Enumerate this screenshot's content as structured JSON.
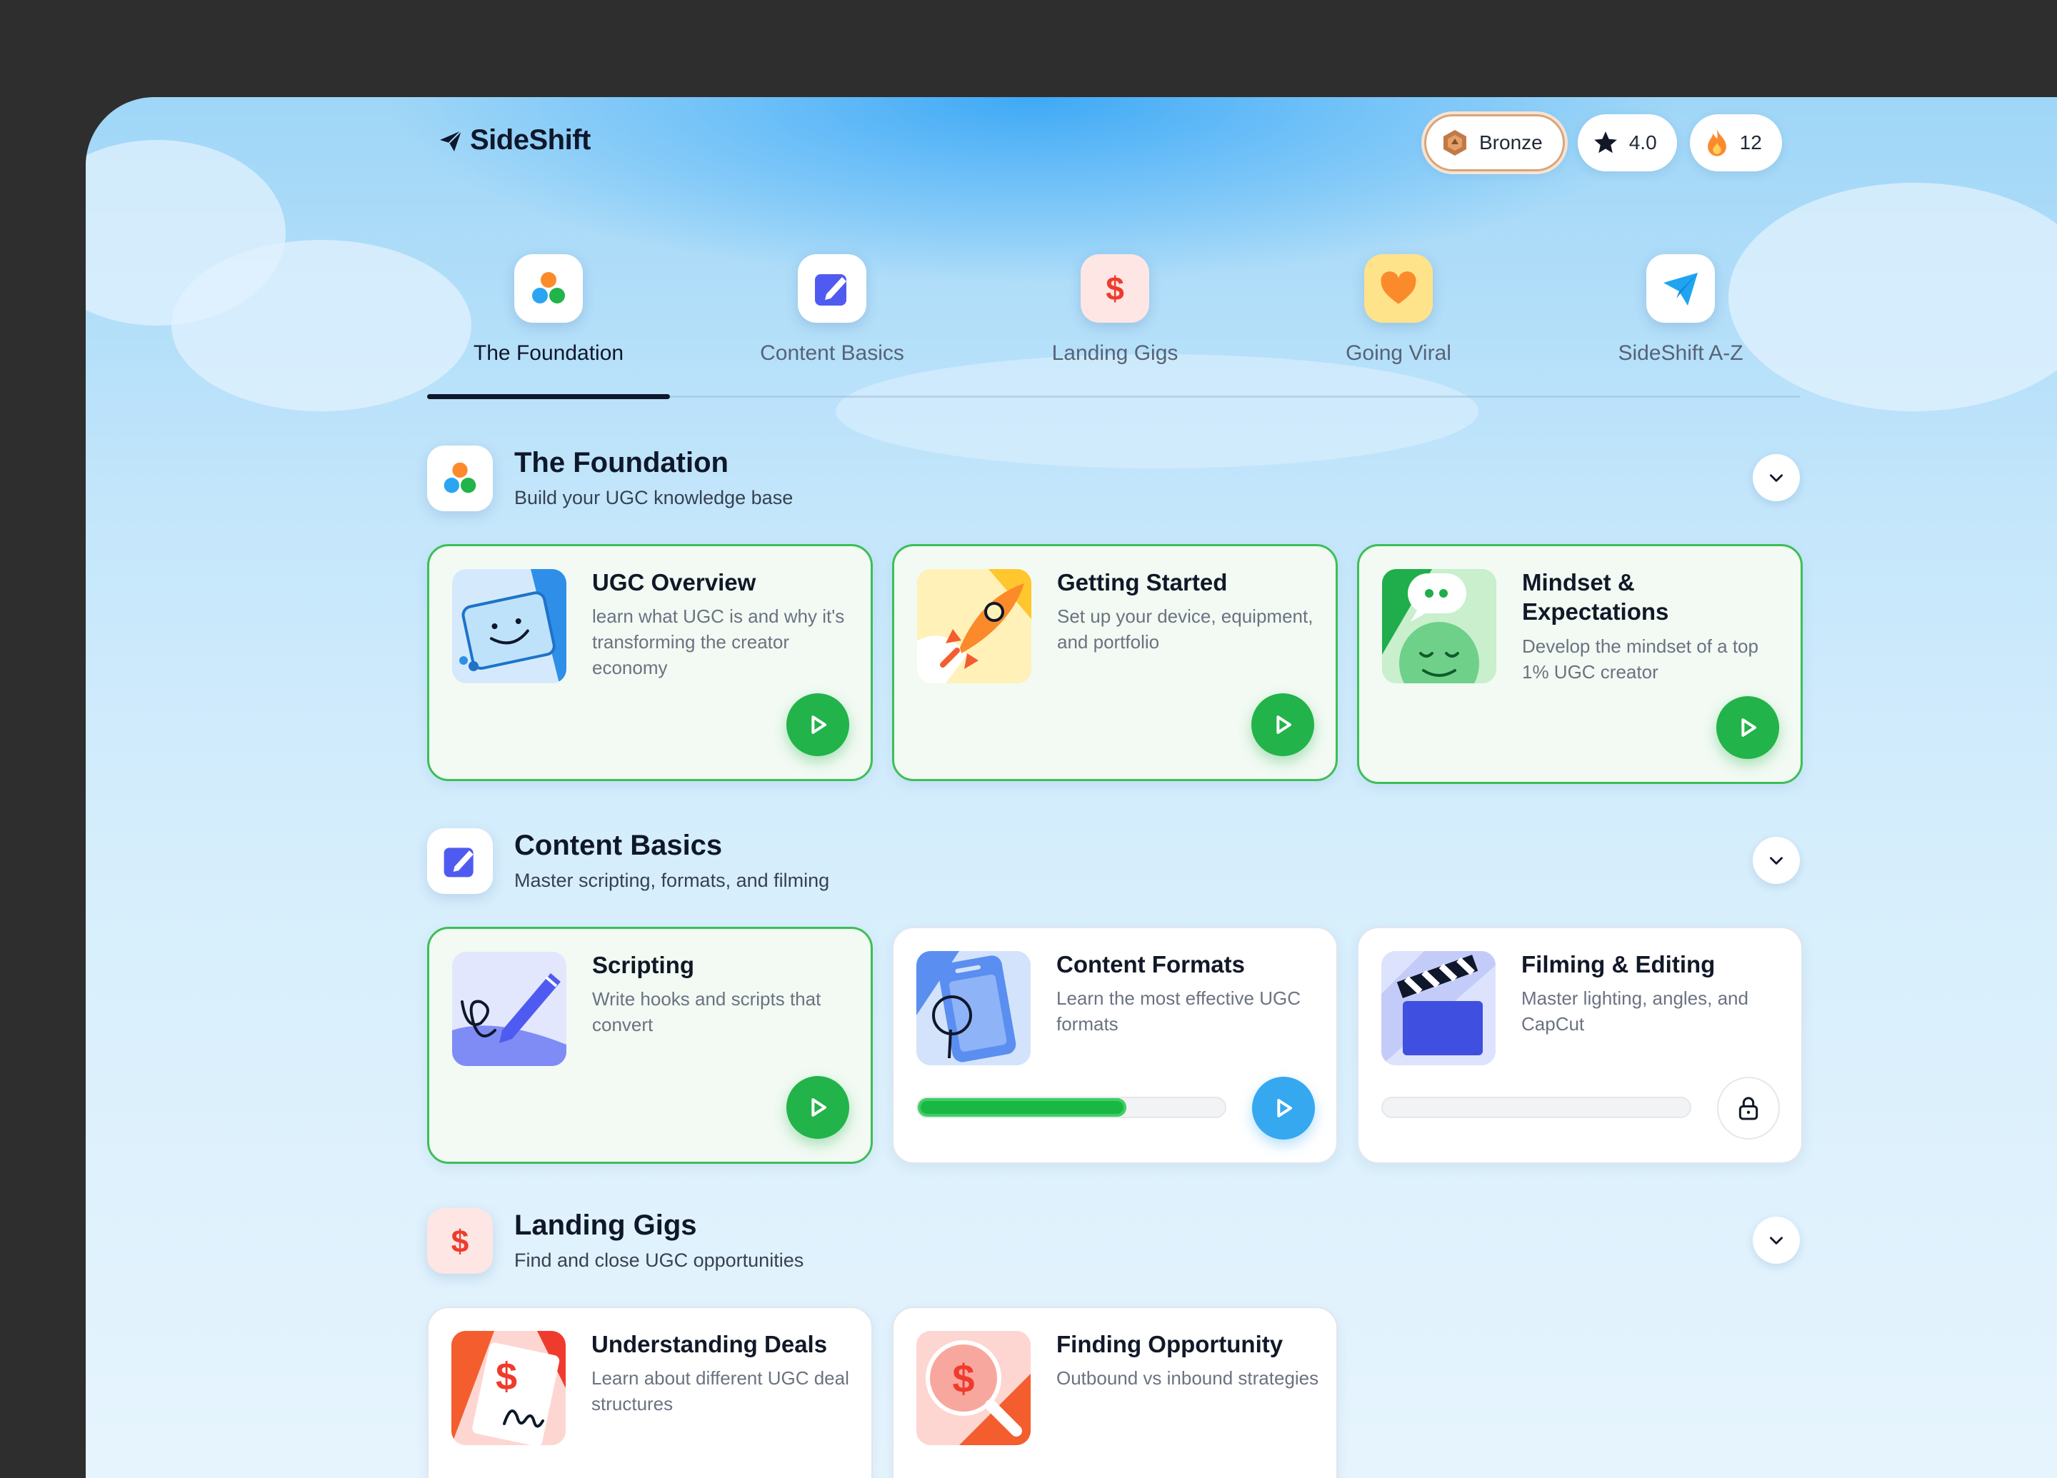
{
  "brand": {
    "name": "SideShift"
  },
  "status": {
    "tier": "Bronze",
    "rating": "4.0",
    "streak": "12"
  },
  "tabs": [
    {
      "label": "The Foundation",
      "icon": "dots-icon"
    },
    {
      "label": "Content Basics",
      "icon": "edit-icon"
    },
    {
      "label": "Landing Gigs",
      "icon": "dollar-icon"
    },
    {
      "label": "Going Viral",
      "icon": "heart-icon"
    },
    {
      "label": "SideShift A-Z",
      "icon": "paper-plane-icon"
    }
  ],
  "active_tab": "The Foundation",
  "sections": [
    {
      "title": "The Foundation",
      "subtitle": "Build your UGC knowledge base",
      "cards": [
        {
          "title": "UGC Overview",
          "desc": "learn what UGC is and why it's transforming the creator economy",
          "state": "completed"
        },
        {
          "title": "Getting Started",
          "desc": "Set up your device, equipment, and portfolio",
          "state": "completed"
        },
        {
          "title": "Mindset & Expectations",
          "desc": "Develop the mindset of a top 1% UGC creator",
          "state": "completed"
        }
      ]
    },
    {
      "title": "Content Basics",
      "subtitle": "Master scripting, formats, and filming",
      "cards": [
        {
          "title": "Scripting",
          "desc": "Write hooks and scripts that convert",
          "state": "completed"
        },
        {
          "title": "Content Formats",
          "desc": "Learn the most effective UGC formats",
          "state": "in-progress",
          "progress": 0.68
        },
        {
          "title": "Filming & Editing",
          "desc": "Master lighting, angles, and CapCut",
          "state": "locked",
          "progress": 0
        }
      ]
    },
    {
      "title": "Landing Gigs",
      "subtitle": "Find and close UGC opportunities",
      "cards": [
        {
          "title": "Understanding Deals",
          "desc": "Learn about different UGC deal structures",
          "state": "locked"
        },
        {
          "title": "Finding Opportunity",
          "desc": "Outbound vs inbound strategies",
          "state": "locked"
        }
      ]
    }
  ],
  "colors": {
    "completed": "#22b34a",
    "in_progress": "#35a8f0",
    "progress_fill": "#19b844",
    "bronze": "#c17a45"
  }
}
